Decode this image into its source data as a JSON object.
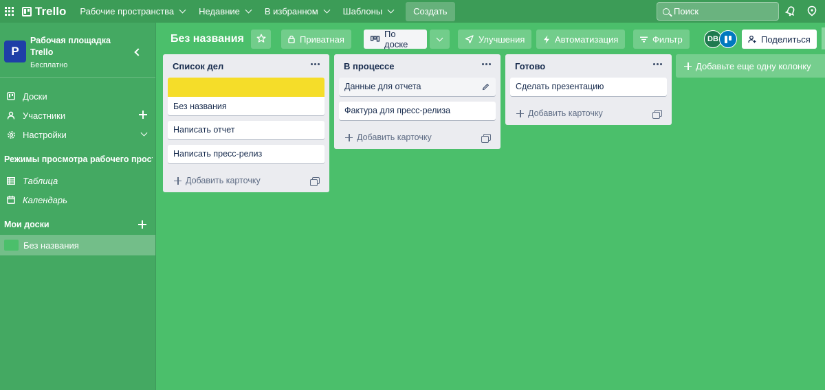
{
  "topbar": {
    "app_name": "Trello",
    "menu": [
      {
        "label": "Рабочие пространства"
      },
      {
        "label": "Недавние"
      },
      {
        "label": "В избранном"
      },
      {
        "label": "Шаблоны"
      }
    ],
    "create_label": "Создать",
    "search_placeholder": "Поиск"
  },
  "sidebar": {
    "workspace_initial": "P",
    "workspace_name": "Рабочая площадка Trello",
    "workspace_plan": "Бесплатно",
    "items": [
      {
        "label": "Доски"
      },
      {
        "label": "Участники"
      },
      {
        "label": "Настройки"
      }
    ],
    "views_heading": "Режимы просмотра рабочего пространства",
    "views": [
      {
        "label": "Таблица"
      },
      {
        "label": "Календарь"
      }
    ],
    "boards_heading": "Мои доски",
    "boards": [
      {
        "label": "Без названия",
        "color": "#4bbf6b"
      }
    ]
  },
  "board": {
    "title": "Без названия",
    "visibility_label": "Приватная",
    "view_label": "По доске",
    "powerups_label": "Улучшения",
    "automation_label": "Автоматизация",
    "filter_label": "Фильтр",
    "member_initials": "DB",
    "share_label": "Поделиться",
    "background_color": "#4bbf6b"
  },
  "lists": [
    {
      "title": "Список дел",
      "cards": [
        {
          "title": "Без названия",
          "cover_color": "#f5dd29"
        },
        {
          "title": "Написать отчет"
        },
        {
          "title": "Написать пресс-релиз"
        }
      ],
      "add_card_label": "Добавить карточку"
    },
    {
      "title": "В процессе",
      "cards": [
        {
          "title": "Данные для отчета"
        },
        {
          "title": "Фактура для пресс-релиза"
        }
      ],
      "add_card_label": "Добавить карточку"
    },
    {
      "title": "Готово",
      "cards": [
        {
          "title": "Сделать презентацию"
        }
      ],
      "add_card_label": "Добавить карточку"
    }
  ],
  "add_column_label": "Добавьте еще одну колонку"
}
